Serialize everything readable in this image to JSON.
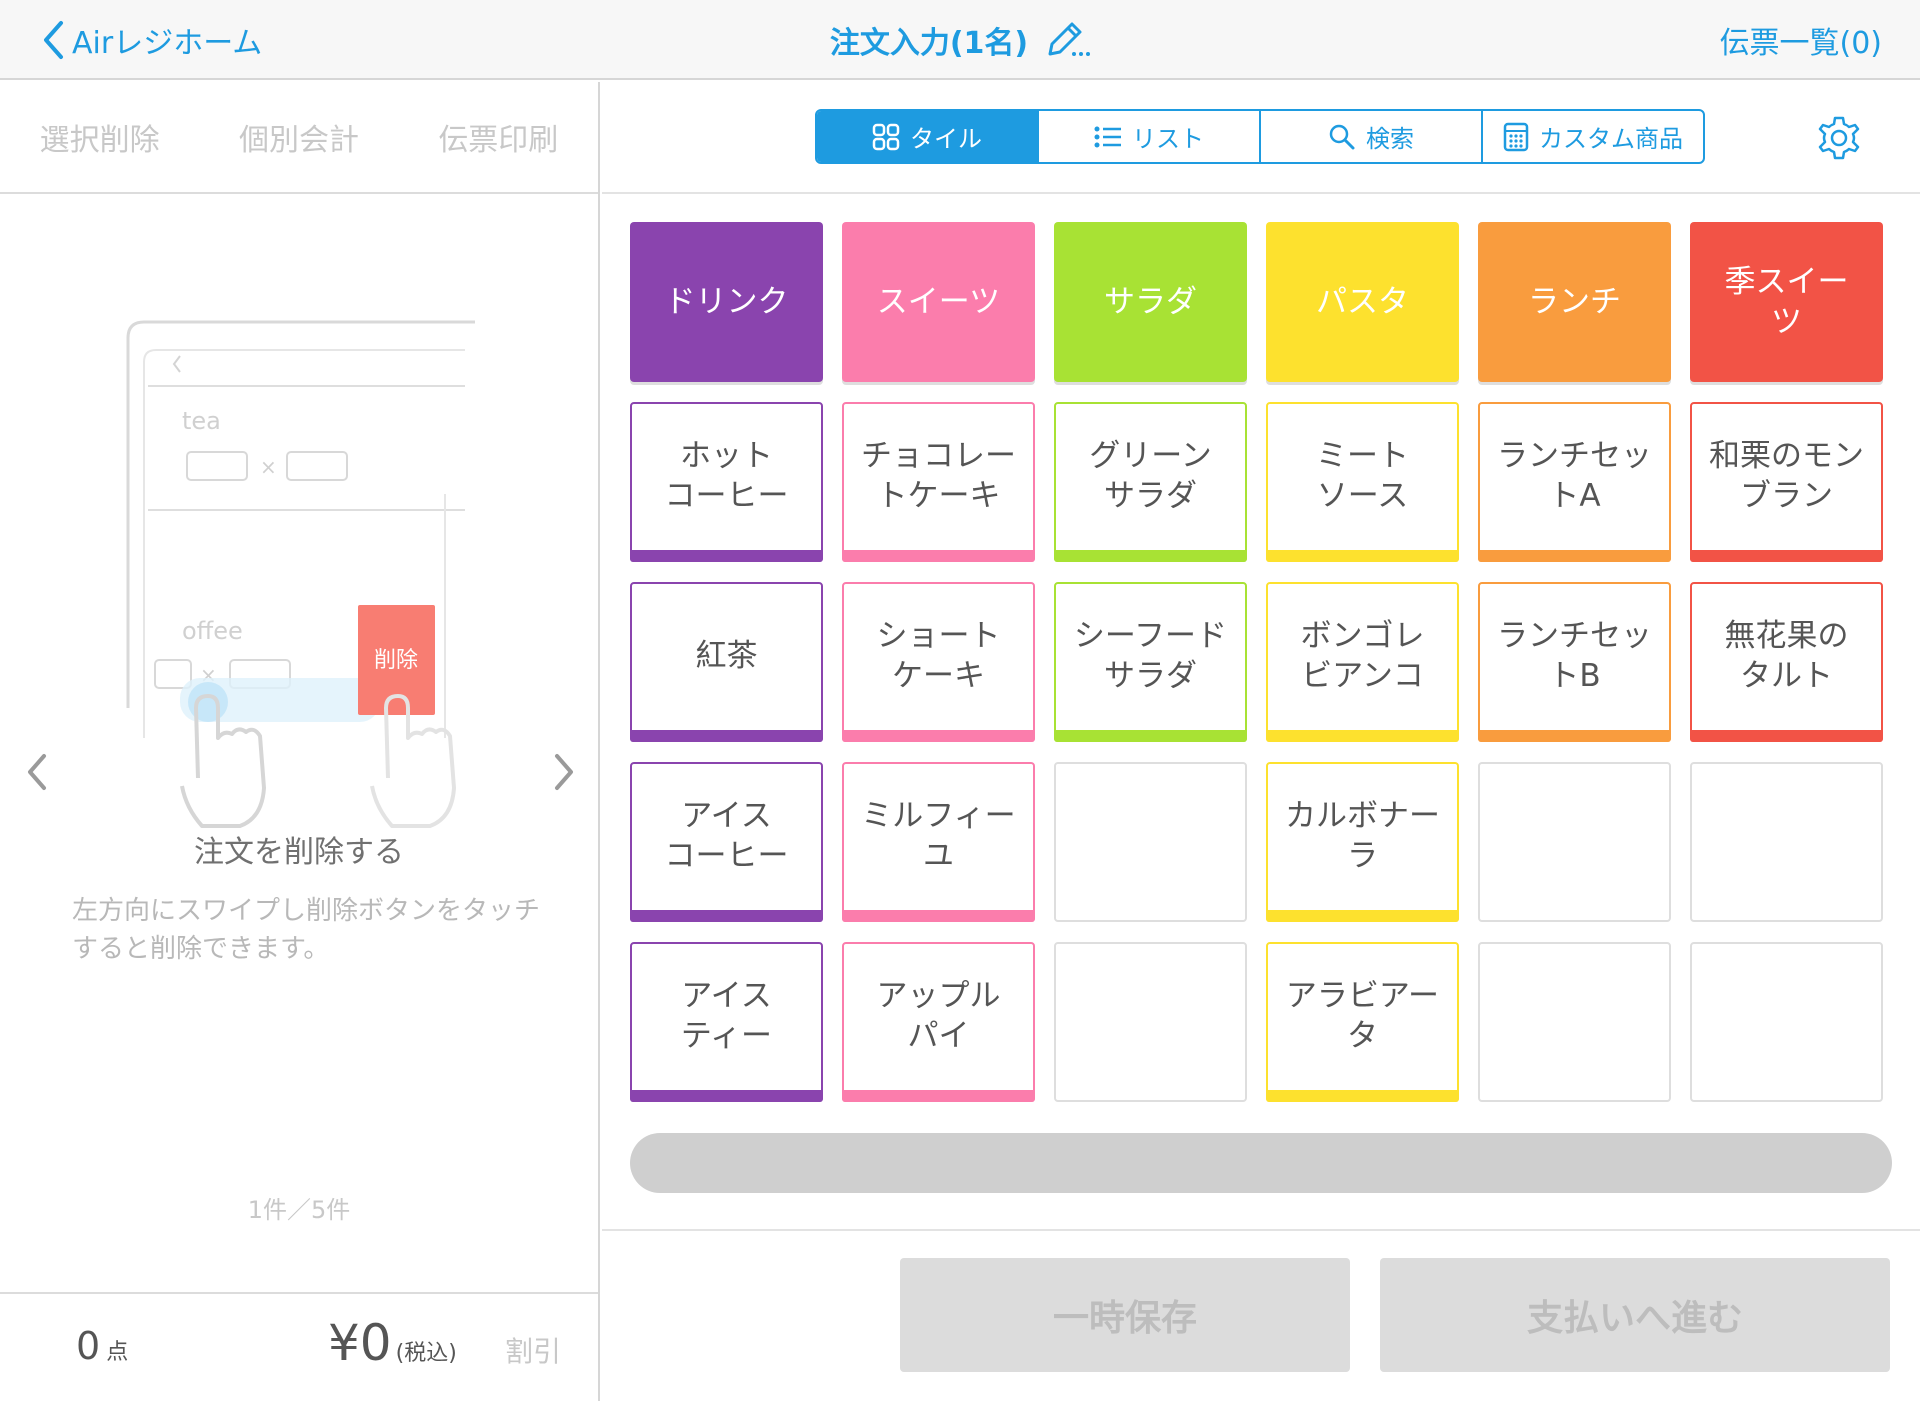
{
  "header": {
    "back_label": "Airレジホーム",
    "title": "注文入力(1名)",
    "slip_list": "伝票一覧(0)"
  },
  "left": {
    "actions": [
      "選択削除",
      "個別会計",
      "伝票印刷"
    ],
    "illustration": {
      "row1": "tea",
      "row2": "offee",
      "delete_label": "削除"
    },
    "help_title": "注文を削除する",
    "help_desc": "左方向にスワイプし削除ボタンをタッチすると削除できます。",
    "pager": "1件／5件",
    "count": "0",
    "count_unit": "点",
    "amount": "¥0",
    "amount_note": "(税込)",
    "discount": "割引"
  },
  "view_tabs": {
    "tile": "タイル",
    "list": "リスト",
    "search": "検索",
    "custom": "カスタム商品"
  },
  "colors": {
    "accent": "#1e9be0",
    "drink": "#8a44ae",
    "sweets": "#fb7dac",
    "salad": "#a8e234",
    "pasta": "#fde12e",
    "lunch": "#f99c3e",
    "season": "#f25346"
  },
  "categories": [
    {
      "label": "ドリンク",
      "color": "#8a44ae"
    },
    {
      "label": "スイーツ",
      "color": "#fb7dac"
    },
    {
      "label": "サラダ",
      "color": "#a8e234"
    },
    {
      "label": "パスタ",
      "color": "#fde12e"
    },
    {
      "label": "ランチ",
      "color": "#f99c3e"
    },
    {
      "label": "季スイー\nツ",
      "color": "#f25346"
    }
  ],
  "items": [
    [
      "ホット\nコーヒー",
      "チョコレー\nトケーキ",
      "グリーン\nサラダ",
      "ミート\nソース",
      "ランチセッ\nトA",
      "和栗のモン\nブラン"
    ],
    [
      "紅茶",
      "ショート\nケーキ",
      "シーフード\nサラダ",
      "ボンゴレ\nビアンコ",
      "ランチセッ\nトB",
      "無花果の\nタルト"
    ],
    [
      "アイス\nコーヒー",
      "ミルフィー\nユ",
      "",
      "カルボナー\nラ",
      "",
      ""
    ],
    [
      "アイス\nティー",
      "アップル\nパイ",
      "",
      "アラビアー\nタ",
      "",
      ""
    ]
  ],
  "buttons": {
    "save": "一時保存",
    "pay": "支払いへ進む"
  }
}
